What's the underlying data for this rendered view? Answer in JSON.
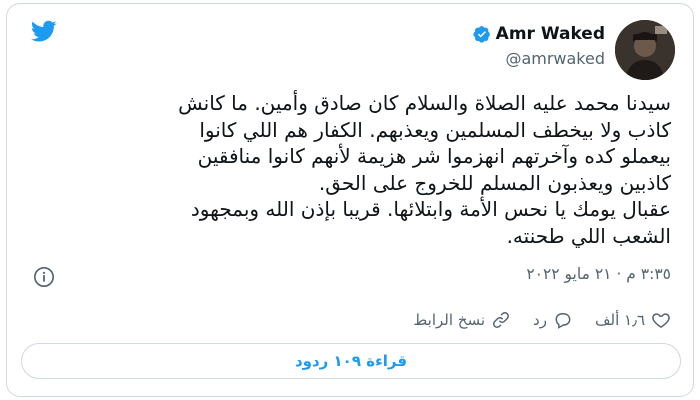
{
  "author": {
    "display_name": "Amr Waked",
    "handle": "@amrwaked",
    "verified": true
  },
  "tweet": {
    "lines": [
      "سيدنا محمد عليه الصلاة والسلام كان صادق وأمين. ما كانش",
      "كاذب ولا بيخطف المسلمين ويعذبهم. الكفار هم اللي كانوا",
      "بيعملو كده وآخرتهم انهزموا شر هزيمة لأنهم كانوا منافقين",
      "كاذبين ويعذبون المسلم للخروج على الحق.",
      "عقبال يومك يا نحس الأمة وابتلائها. قريبا بإذن الله وبمجهود",
      "الشعب اللي طحنته."
    ],
    "timestamp": "٣:٣٥ م · ٢١ مايو ٢٠٢٢"
  },
  "actions": {
    "like_count": "١٫٦ ألف",
    "reply_label": "رد",
    "copy_link_label": "نسخ الرابط"
  },
  "replies_button": {
    "label": "قراءة ١٠٩ ردود"
  },
  "colors": {
    "brand": "#1d9bf0",
    "text": "#0f1419",
    "muted": "#536471",
    "border": "#cfd9de"
  },
  "icons": [
    "twitter-bird-icon",
    "verified-badge-icon",
    "info-icon",
    "heart-icon",
    "reply-icon",
    "link-icon"
  ]
}
